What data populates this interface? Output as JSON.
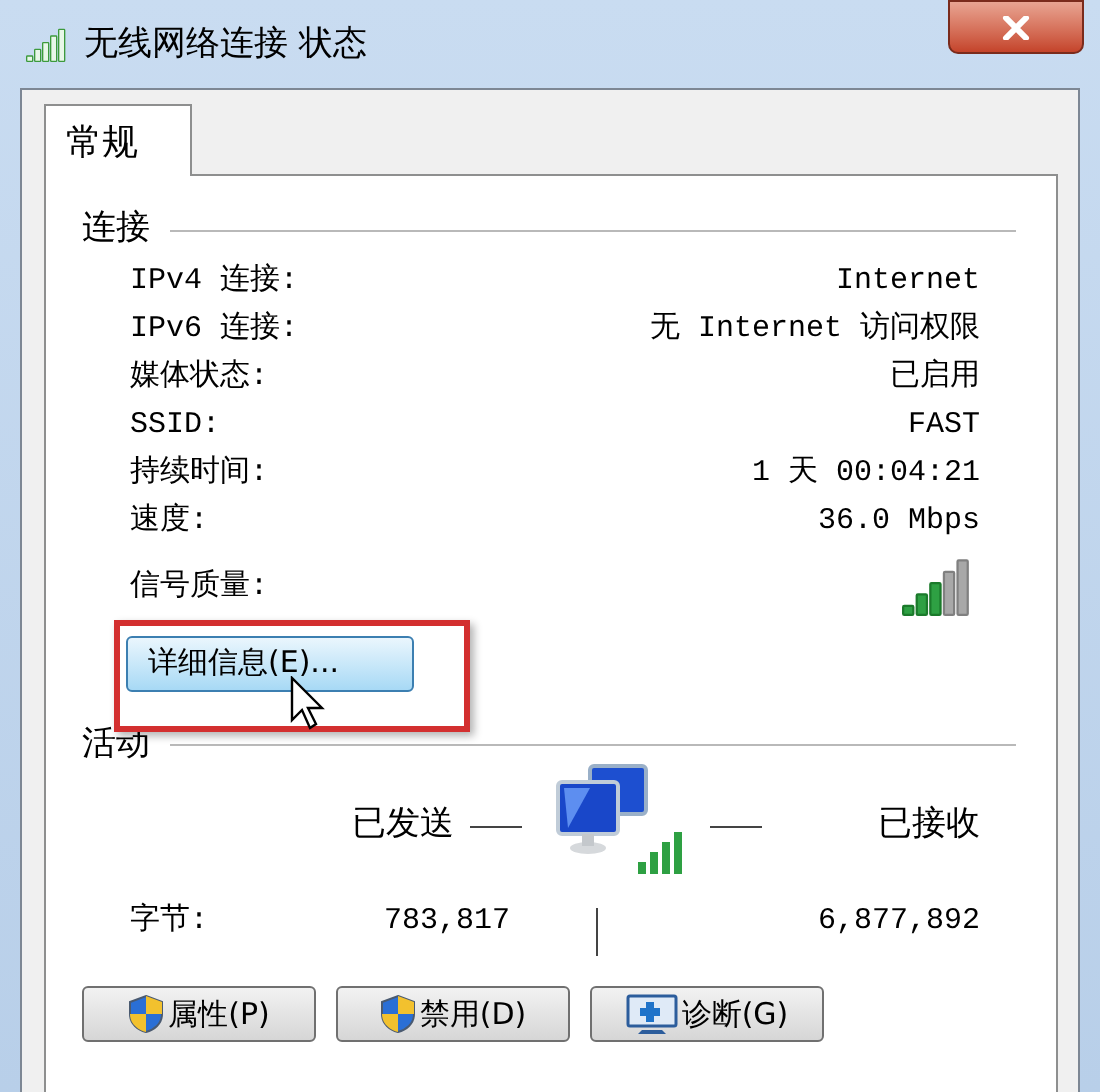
{
  "window": {
    "title": "无线网络连接 状态"
  },
  "tabs": [
    {
      "label": "常规",
      "selected": true
    }
  ],
  "connection": {
    "heading": "连接",
    "rows": [
      {
        "label": "IPv4 连接:",
        "value": "Internet"
      },
      {
        "label": "IPv6 连接:",
        "value": "无 Internet 访问权限"
      },
      {
        "label": "媒体状态:",
        "value": "已启用"
      },
      {
        "label": "SSID:",
        "value": "FAST"
      },
      {
        "label": "持续时间:",
        "value": "1 天 00:04:21"
      },
      {
        "label": "速度:",
        "value": "36.0 Mbps"
      }
    ],
    "signal_label": "信号质量:",
    "details_button": "详细信息(E)..."
  },
  "activity": {
    "heading": "活动",
    "sent_label": "已发送",
    "received_label": "已接收",
    "bytes_label": "字节:",
    "bytes_sent": "783,817",
    "bytes_received": "6,877,892"
  },
  "buttons": [
    {
      "label": "属性(P)",
      "kind": "shield"
    },
    {
      "label": "禁用(D)",
      "kind": "shield"
    },
    {
      "label": "诊断(G)",
      "kind": "diagnose"
    }
  ]
}
